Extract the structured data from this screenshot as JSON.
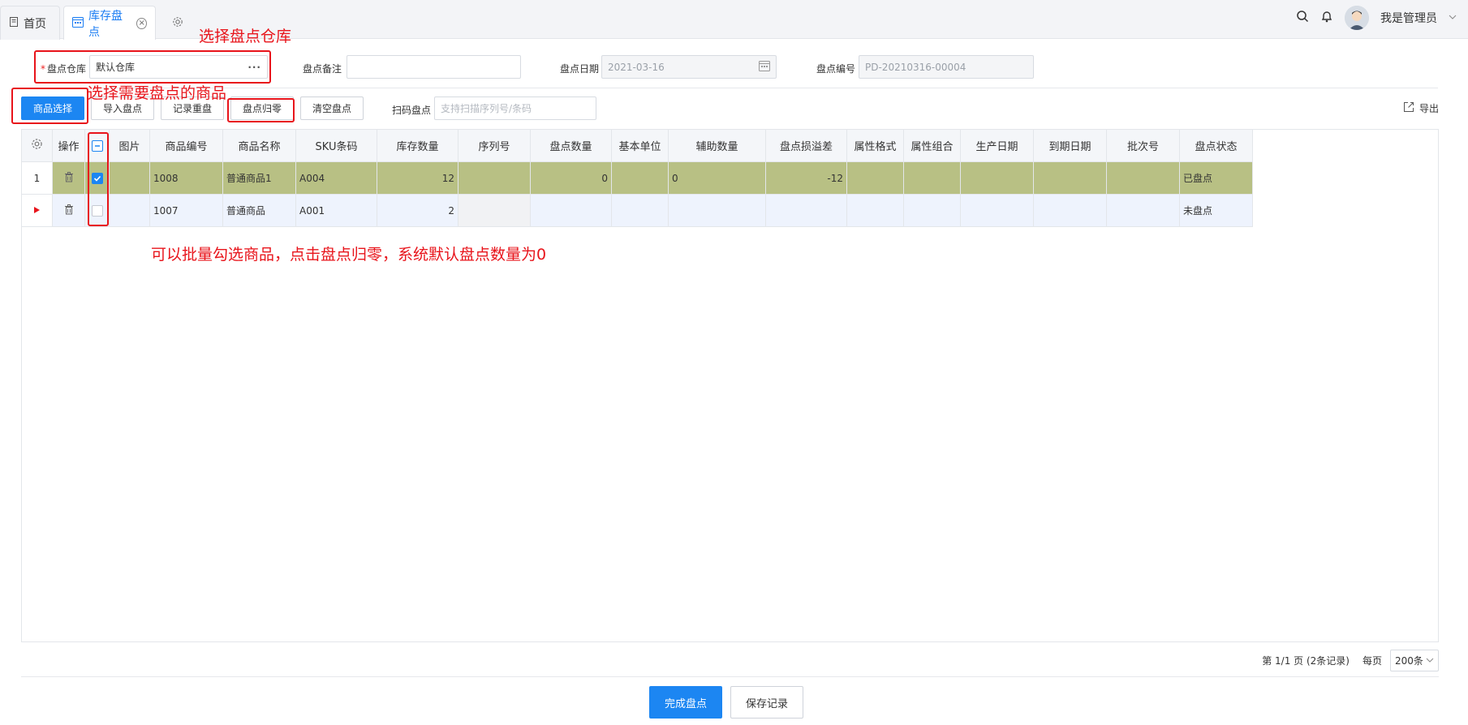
{
  "tabs": [
    {
      "label": "首页"
    },
    {
      "label": "库存盘点"
    }
  ],
  "user": {
    "name": "我是管理员"
  },
  "form": {
    "warehouse_label": "盘点仓库",
    "warehouse_value": "默认仓库",
    "remark_label": "盘点备注",
    "remark_value": "",
    "date_label": "盘点日期",
    "date_value": "2021-03-16",
    "code_label": "盘点编号",
    "code_value": "PD-20210316-00004"
  },
  "toolbar": {
    "select_goods": "商品选择",
    "import": "导入盘点",
    "record_reset": "记录重盘",
    "zero": "盘点归零",
    "clear": "清空盘点",
    "scan_label": "扫码盘点",
    "scan_placeholder": "支持扫描序列号/条码",
    "export": "导出"
  },
  "annotations": {
    "warehouse": "选择盘点仓库",
    "goods": "选择需要盘点的商品",
    "batch": "可以批量勾选商品，点击盘点归零，系统默认盘点数量为0"
  },
  "table": {
    "columns": [
      "操作",
      "图片",
      "商品编号",
      "商品名称",
      "SKU条码",
      "库存数量",
      "序列号",
      "盘点数量",
      "基本单位",
      "辅助数量",
      "盘点损溢差",
      "属性格式",
      "属性组合",
      "生产日期",
      "到期日期",
      "批次号",
      "盘点状态"
    ],
    "rows": [
      {
        "index": "1",
        "code": "1008",
        "name": "普通商品1",
        "sku": "A004",
        "stock": "12",
        "serial": "",
        "count": "0",
        "unit": "",
        "aux": "0",
        "diff": "-12",
        "status": "已盘点",
        "checked": true
      },
      {
        "index": "",
        "code": "1007",
        "name": "普通商品",
        "sku": "A001",
        "stock": "2",
        "serial": "",
        "count": "",
        "unit": "",
        "aux": "",
        "diff": "",
        "status": "未盘点",
        "checked": false
      }
    ]
  },
  "pager": {
    "info": "第 1/1 页 (2条记录)",
    "per_page_label": "每页",
    "per_page_value": "200条"
  },
  "footer": {
    "finish": "完成盘点",
    "save": "保存记录"
  },
  "colors": {
    "primary": "#1c86f2",
    "annotation": "#e8141b",
    "checked_row": "#b8c084",
    "active_row": "#eef3fd"
  }
}
